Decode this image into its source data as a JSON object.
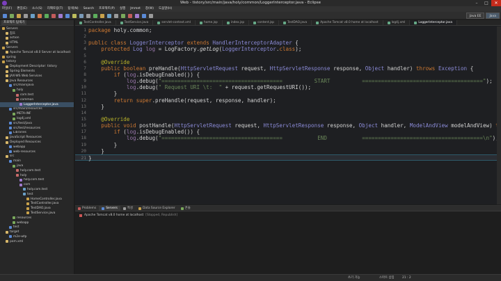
{
  "window": {
    "title": "Web - tistory/src/main/java/holy/common/LoggerInterceptor.java - Eclipse"
  },
  "menu": [
    "파일(F)",
    "편집(E)",
    "소스(S)",
    "리팩토링(T)",
    "탐색(N)",
    "Search",
    "프로젝트(P)",
    "실행",
    "Jmmet",
    "창(W)",
    "도움말(H)"
  ],
  "perspectives": [
    "Java EE",
    "Java"
  ],
  "explorer": {
    "tab": "프로젝트 탐색기",
    "items": [
      {
        "label": "Servers",
        "level": 0
      },
      {
        "label": "참조",
        "level": 1
      },
      {
        "label": "action",
        "level": 1
      },
      {
        "label": "HTML",
        "level": 1
      },
      {
        "label": "Servers",
        "level": 0
      },
      {
        "label": "Apache Tomcat v8.0 Server at localhost",
        "level": 1
      },
      {
        "label": "spring",
        "level": 0
      },
      {
        "label": "tistory",
        "level": 0
      },
      {
        "label": "Deployment Descriptor: tistory",
        "level": 1
      },
      {
        "label": "Spring Elements",
        "level": 1
      },
      {
        "label": "JAX-WS Web Services",
        "level": 1
      },
      {
        "label": "Java Resources",
        "level": 1
      },
      {
        "label": "src/main/java",
        "level": 2
      },
      {
        "label": "holy",
        "level": 3
      },
      {
        "label": "com.test",
        "level": 4
      },
      {
        "label": "common",
        "level": 4
      },
      {
        "label": "LoggerInterceptor.java",
        "level": 5,
        "selected": true
      },
      {
        "label": "src/main/resources",
        "level": 2
      },
      {
        "label": "META-INF",
        "level": 3
      },
      {
        "label": "log4j.xml",
        "level": 3
      },
      {
        "label": "src/test/java",
        "level": 2
      },
      {
        "label": "src/test/resources",
        "level": 2
      },
      {
        "label": "Libraries",
        "level": 2
      },
      {
        "label": "JavaScript Resources",
        "level": 1
      },
      {
        "label": "Deployed Resources",
        "level": 1
      },
      {
        "label": "webapp",
        "level": 2
      },
      {
        "label": "web-resources",
        "level": 2
      },
      {
        "label": "src",
        "level": 1
      },
      {
        "label": "main",
        "level": 2
      },
      {
        "label": "java",
        "level": 3
      },
      {
        "label": "holy.com.test",
        "level": 4
      },
      {
        "label": "holy",
        "level": 4
      },
      {
        "label": "holy.com.test",
        "level": 5
      },
      {
        "label": "com",
        "level": 5
      },
      {
        "label": "holy.com.test",
        "level": 6
      },
      {
        "label": "test",
        "level": 6
      },
      {
        "label": "HomeController.java",
        "level": 7
      },
      {
        "label": "TestController.java",
        "level": 7
      },
      {
        "label": "TestDAO.java",
        "level": 7
      },
      {
        "label": "TestService.java",
        "level": 7
      },
      {
        "label": "resources",
        "level": 3
      },
      {
        "label": "webapp",
        "level": 3
      },
      {
        "label": "test",
        "level": 2
      },
      {
        "label": "target",
        "level": 1
      },
      {
        "label": "m2e-wtp",
        "level": 2
      },
      {
        "label": "pom.xml",
        "level": 1
      }
    ]
  },
  "editor": {
    "tabs": [
      {
        "label": "TestController.java",
        "active": false
      },
      {
        "label": "TestService.java",
        "active": false
      },
      {
        "label": "servlet-context.xml",
        "active": false
      },
      {
        "label": "home.jsp",
        "active": false
      },
      {
        "label": "index.jsp",
        "active": false
      },
      {
        "label": "content.jsp",
        "active": false
      },
      {
        "label": "TestDAO.java",
        "active": false
      },
      {
        "label": "Apache Tomcat v8.0 home at localhost",
        "active": false
      },
      {
        "label": "log4j.xml",
        "active": false
      },
      {
        "label": "LoggerInterceptor.java",
        "active": true
      }
    ],
    "current_line": 22
  },
  "bottom": {
    "tabs": [
      {
        "label": "Problems",
        "active": false
      },
      {
        "label": "Servers",
        "active": true
      },
      {
        "label": "특성",
        "active": false
      },
      {
        "label": "Data Source Explorer",
        "active": false
      },
      {
        "label": "콘솔",
        "active": false
      }
    ],
    "server": {
      "name": "Apache Tomcat v8.0 home at localhost",
      "state": "[Stopped, Republish]"
    }
  },
  "status": {
    "mode": "쓰기 가능",
    "insert": "스마트 삽입",
    "position": "21 : 2"
  }
}
